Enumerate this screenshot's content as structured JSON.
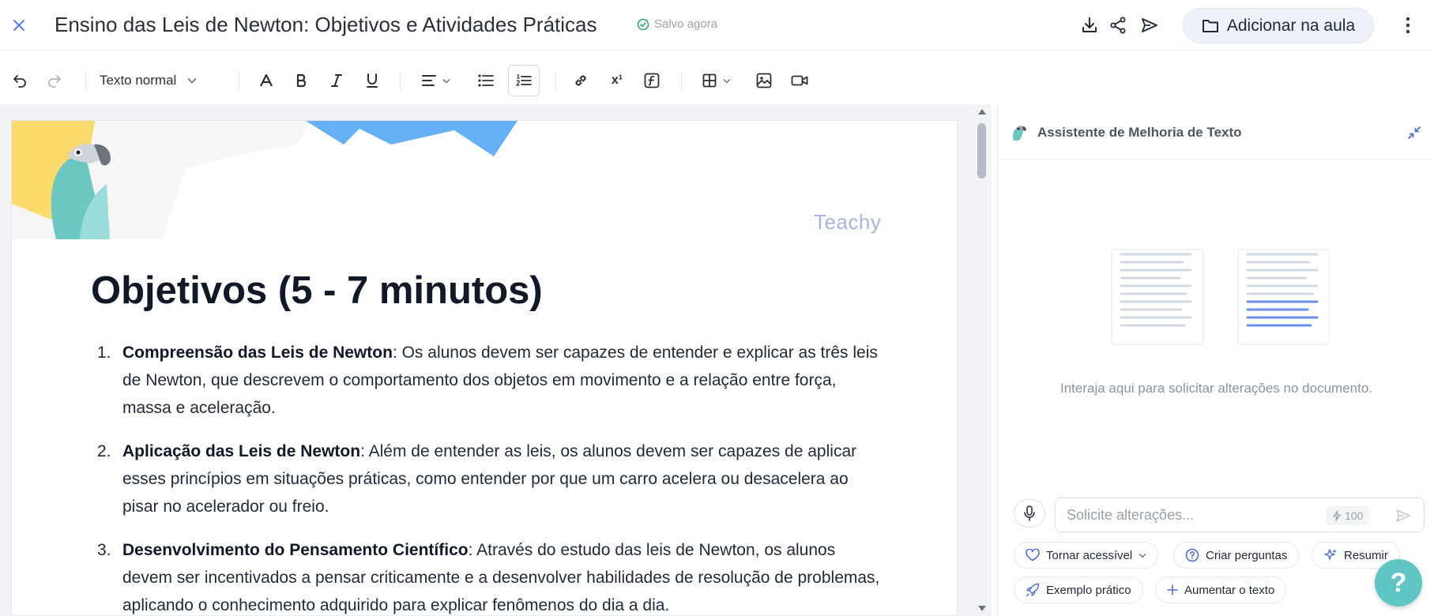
{
  "header": {
    "title": "Ensino das Leis de Newton: Objetivos e Atividades Práticas",
    "saved_status": "Salvo agora",
    "add_lesson_label": "Adicionar na aula"
  },
  "toolbar": {
    "text_style": "Texto normal",
    "superscript_label": "x¹"
  },
  "document": {
    "brand": "Teachy",
    "heading": "Objetivos (5 - 7 minutos)",
    "items": [
      {
        "number": "1.",
        "title": "Compreensão das Leis de Newton",
        "text": ": Os alunos devem ser capazes de entender e explicar as três leis de Newton, que descrevem o comportamento dos objetos em movimento e a relação entre força, massa e aceleração."
      },
      {
        "number": "2.",
        "title": "Aplicação das Leis de Newton",
        "text": ": Além de entender as leis, os alunos devem ser capazes de aplicar esses princípios em situações práticas, como entender por que um carro acelera ou desacelera ao pisar no acelerador ou freio."
      },
      {
        "number": "3.",
        "title": "Desenvolvimento do Pensamento Científico",
        "text": ": Através do estudo das leis de Newton, os alunos devem ser incentivados a pensar criticamente e a desenvolver habilidades de resolução de problemas, aplicando o conhecimento adquirido para explicar fenômenos do dia a dia."
      }
    ]
  },
  "assistant": {
    "title": "Assistente de Melhoria de Texto",
    "hint": "Interaja aqui para solicitar alterações no documento.",
    "input_placeholder": "Solicite alterações...",
    "credits": "100",
    "chips": {
      "accessible": "Tornar acessível",
      "questions": "Criar perguntas",
      "summarize": "Resumir",
      "example": "Exemplo prático",
      "expand": "Aumentar o texto"
    }
  },
  "help_label": "?",
  "colors": {
    "accent": "#4b6bd6",
    "help": "#5fc6c4",
    "saved": "#22a06b",
    "banner_yellow": "#fbd96a",
    "banner_blue": "#66b0f5"
  }
}
